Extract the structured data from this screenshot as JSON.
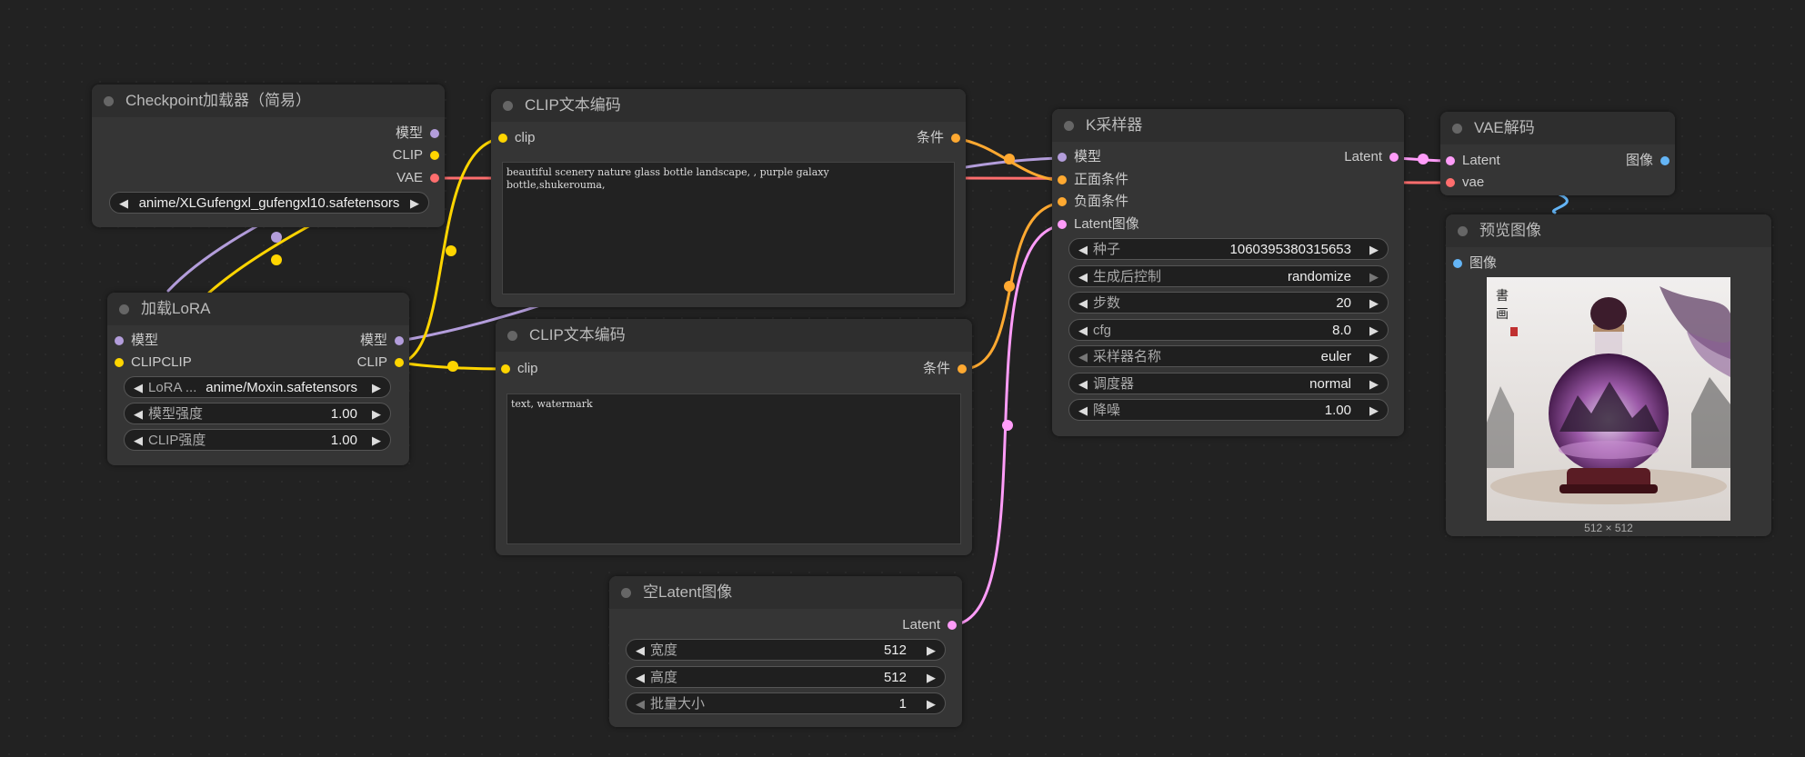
{
  "colors": {
    "model": "#b39ddb",
    "clip": "#ffd500",
    "vae": "#ff6e6e",
    "cond": "#ffa931",
    "latent": "#ff9cf9",
    "image": "#64b5f6"
  },
  "checkpoint": {
    "title": "Checkpoint加载器（简易）",
    "out_model": "模型",
    "out_clip": "CLIP",
    "out_vae": "VAE",
    "ckpt_name": "anime/XLGufengxl_gufengxl10.safetensors"
  },
  "lora": {
    "title": "加载LoRA",
    "in_model": "模型",
    "in_clip": "CLIPCLIP",
    "out_model": "模型",
    "out_clip": "CLIP",
    "lora_label": "LoRA ...",
    "lora_value": "anime/Moxin.safetensors",
    "strength_model_label": "模型强度",
    "strength_model_value": "1.00",
    "strength_clip_label": "CLIP强度",
    "strength_clip_value": "1.00"
  },
  "clip_pos": {
    "title": "CLIP文本编码",
    "in_clip": "clip",
    "out_cond": "条件",
    "text": "beautiful scenery nature glass bottle landscape, , purple galaxy\nbottle,shukerouma,"
  },
  "clip_neg": {
    "title": "CLIP文本编码",
    "in_clip": "clip",
    "out_cond": "条件",
    "text": "text, watermark"
  },
  "latent": {
    "title": "空Latent图像",
    "out_latent": "Latent",
    "width_label": "宽度",
    "width_value": "512",
    "height_label": "高度",
    "height_value": "512",
    "batch_label": "批量大小",
    "batch_value": "1"
  },
  "ksampler": {
    "title": "K采样器",
    "in_model": "模型",
    "in_pos": "正面条件",
    "in_neg": "负面条件",
    "in_latent": "Latent图像",
    "out_latent": "Latent",
    "seed_label": "种子",
    "seed_value": "1060395380315653",
    "control_label": "生成后控制",
    "control_value": "randomize",
    "steps_label": "步数",
    "steps_value": "20",
    "cfg_label": "cfg",
    "cfg_value": "8.0",
    "sampler_label": "采样器名称",
    "sampler_value": "euler",
    "scheduler_label": "调度器",
    "scheduler_value": "normal",
    "denoise_label": "降噪",
    "denoise_value": "1.00"
  },
  "vae_decode": {
    "title": "VAE解码",
    "in_latent": "Latent",
    "in_vae": "vae",
    "out_image": "图像"
  },
  "preview": {
    "title": "预览图像",
    "in_image": "图像",
    "size_caption": "512 × 512"
  }
}
